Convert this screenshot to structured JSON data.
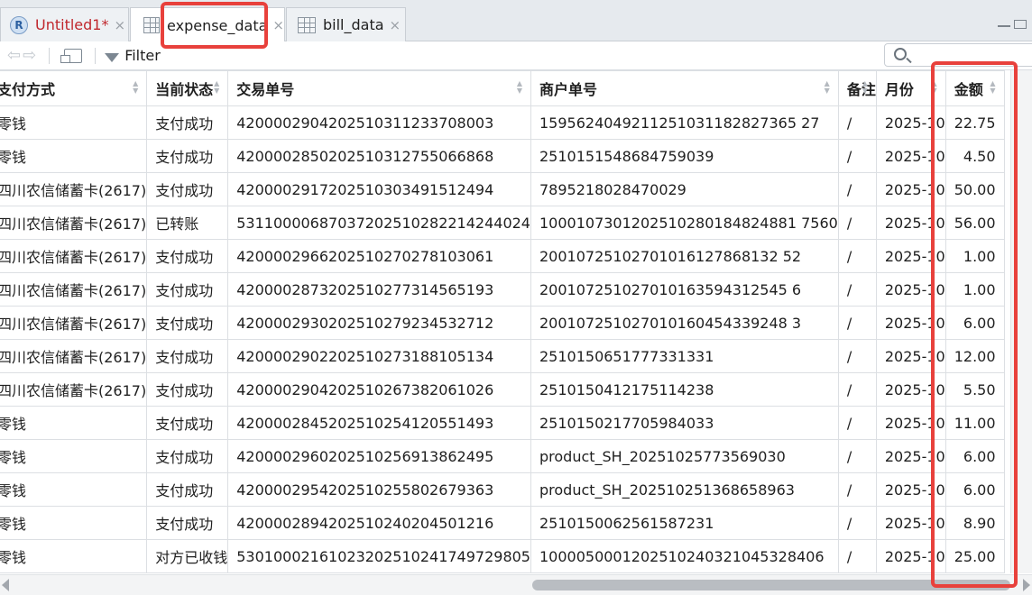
{
  "tabs": [
    {
      "label": "Untitled1*",
      "icon": "r-script-icon",
      "label_color": "#c0272d"
    },
    {
      "label": "expense_data",
      "icon": "data-grid-icon"
    },
    {
      "label": "bill_data",
      "icon": "data-grid-icon"
    }
  ],
  "tab_close_glyph": "×",
  "toolbar": {
    "back_glyph": "⇦",
    "forward_glyph": "⇨",
    "filter_label": "Filter"
  },
  "table": {
    "columns": [
      "支付方式",
      "当前状态",
      "交易单号",
      "商户单号",
      "备注",
      "月份",
      "金额"
    ],
    "rows": [
      [
        "零钱",
        "支付成功",
        "4200002904202510311233708003",
        "1595624049211251031182827365 27",
        "/",
        "2025-10",
        "22.75"
      ],
      [
        "零钱",
        "支付成功",
        "4200002850202510312755066868",
        "2510151548684759039",
        "/",
        "2025-10",
        "4.50"
      ],
      [
        "四川农信储蓄卡(2617)",
        "支付成功",
        "4200002917202510303491512494",
        "7895218028470029",
        "/",
        "2025-10",
        "50.00"
      ],
      [
        "四川农信储蓄卡(2617)",
        "已转账",
        "53110000687037202510282214244024",
        "1000107301202510280184824881 7560",
        "/",
        "2025-10",
        "56.00"
      ],
      [
        "四川农信储蓄卡(2617)",
        "支付成功",
        "4200002966202510270278103061",
        "20010725102701016127868132 52",
        "/",
        "2025-10",
        "1.00"
      ],
      [
        "四川农信储蓄卡(2617)",
        "支付成功",
        "4200002873202510277314565193",
        "200107251027010163594312545 6",
        "/",
        "2025-10",
        "1.00"
      ],
      [
        "四川农信储蓄卡(2617)",
        "支付成功",
        "4200002930202510279234532712",
        "200107251027010160454339248 3",
        "/",
        "2025-10",
        "6.00"
      ],
      [
        "四川农信储蓄卡(2617)",
        "支付成功",
        "4200002902202510273188105134",
        "2510150651777331331",
        "/",
        "2025-10",
        "12.00"
      ],
      [
        "四川农信储蓄卡(2617)",
        "支付成功",
        "4200002904202510267382061026",
        "2510150412175114238",
        "/",
        "2025-10",
        "5.50"
      ],
      [
        "零钱",
        "支付成功",
        "4200002845202510254120551493",
        "2510150217705984033",
        "/",
        "2025-10",
        "11.00"
      ],
      [
        "零钱",
        "支付成功",
        "4200002960202510256913862495",
        "product_SH_20251025773569030",
        "/",
        "2025-10",
        "6.00"
      ],
      [
        "零钱",
        "支付成功",
        "4200002954202510255802679363",
        "product_SH_202510251368658963",
        "/",
        "2025-10",
        "6.00"
      ],
      [
        "零钱",
        "支付成功",
        "4200002894202510240204501216",
        "2510150062561587231",
        "/",
        "2025-10",
        "8.90"
      ],
      [
        "零钱",
        "对方已收钱",
        "53010002161023202510241749729805",
        "1000050001202510240321045328406",
        "/",
        "2025-10",
        "25.00"
      ]
    ]
  },
  "highlight_color": "#e8413c"
}
